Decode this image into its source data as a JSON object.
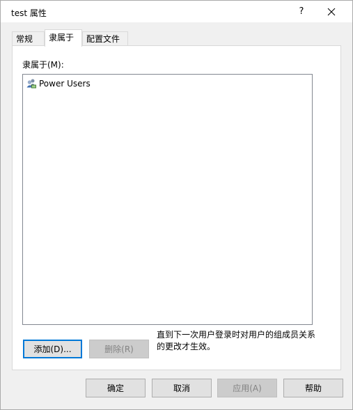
{
  "window": {
    "title": "test 属性",
    "help_label": "?"
  },
  "tabs": [
    {
      "label": "常规",
      "active": false
    },
    {
      "label": "隶属于",
      "active": true
    },
    {
      "label": "配置文件",
      "active": false
    }
  ],
  "member_of": {
    "label": "隶属于(M):",
    "groups": [
      {
        "name": "Power Users",
        "icon": "user-group-icon"
      }
    ],
    "add_label": "添加(D)...",
    "remove_label": "删除(R)",
    "note": "直到下一次用户登录时对用户的组成员关系的更改才生效。"
  },
  "footer": {
    "ok_label": "确定",
    "cancel_label": "取消",
    "apply_label": "应用(A)",
    "help_label": "帮助"
  },
  "colors": {
    "accent": "#0078d7",
    "disabled_text": "#838383"
  }
}
